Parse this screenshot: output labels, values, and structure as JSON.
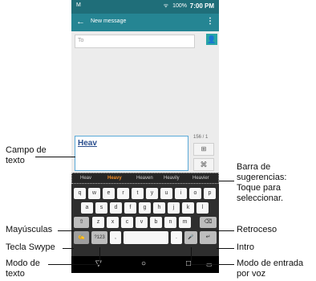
{
  "status_bar": {
    "left": "M",
    "signal": "ᯤ",
    "battery": "100%",
    "time": "7:00 PM"
  },
  "app_bar": {
    "back_icon": "←",
    "title": "New message",
    "menu_icon": "⋮"
  },
  "to_field": {
    "label": "To",
    "contact_icon": "👤"
  },
  "compose": {
    "text": "Heav",
    "char_count": "156 / 1",
    "attach_icon": "⊞",
    "send_icon": "⌘"
  },
  "suggestions": [
    "Heav",
    "Heavy",
    "Heaven",
    "Heavily",
    "Heavier"
  ],
  "keyboard": {
    "row1": [
      "q",
      "w",
      "e",
      "r",
      "t",
      "y",
      "u",
      "i",
      "o",
      "p"
    ],
    "row2": [
      "a",
      "s",
      "d",
      "f",
      "g",
      "h",
      "j",
      "k",
      "l"
    ],
    "row3": [
      "z",
      "x",
      "c",
      "v",
      "b",
      "n",
      "m"
    ],
    "shift": "⇧",
    "backspace": "⌫",
    "swype": "✍",
    "sym": "?123",
    "comma": ",",
    "period": ".",
    "mic": "🎤",
    "enter": "↵"
  },
  "navbar": {
    "back": "▽",
    "home": "○",
    "recent": "□",
    "extra": "▭"
  },
  "callouts": {
    "campo_l1": "Campo de",
    "campo_l2": "texto",
    "barra_l1": "Barra de",
    "barra_l2": "sugerencias:",
    "barra_l3": "Toque para",
    "barra_l4": "seleccionar.",
    "mayusculas": "Mayúsculas",
    "retroceso": "Retroceso",
    "swype": "Tecla Swype",
    "intro": "Intro",
    "modo_texto_l1": "Modo de",
    "modo_texto_l2": "texto",
    "voz_l1": "Modo de entrada",
    "voz_l2": "por voz"
  }
}
